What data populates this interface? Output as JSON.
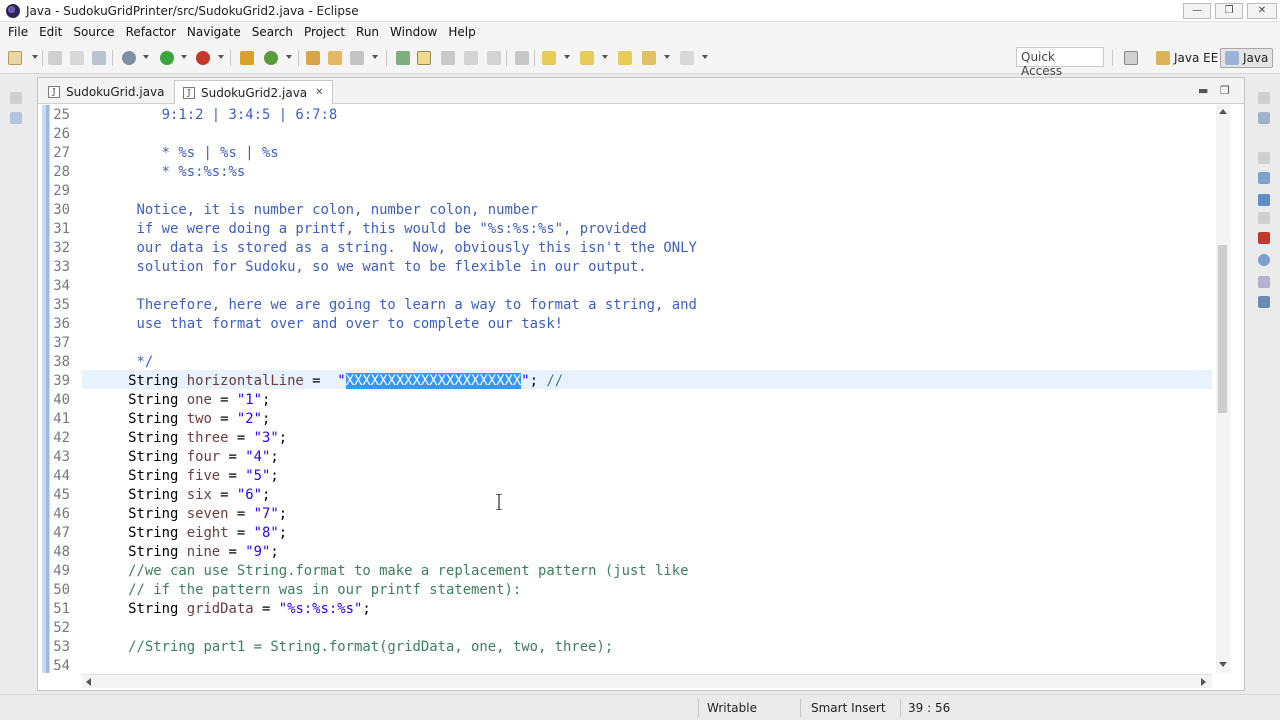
{
  "window": {
    "title": "Java - SudokuGridPrinter/src/SudokuGrid2.java - Eclipse",
    "minimize": "—",
    "maximize": "❐",
    "close": "✕"
  },
  "menu": [
    "File",
    "Edit",
    "Source",
    "Refactor",
    "Navigate",
    "Search",
    "Project",
    "Run",
    "Window",
    "Help"
  ],
  "quick_access": "Quick Access",
  "perspectives": {
    "javaee": "Java EE",
    "java": "Java"
  },
  "tabs": [
    {
      "label": "SudokuGrid.java",
      "active": false
    },
    {
      "label": "SudokuGrid2.java",
      "active": true,
      "close": "✕"
    }
  ],
  "editor": {
    "current_line": 39,
    "lines": [
      {
        "n": "25",
        "segs": [
          {
            "t": "          9:1:2 | 3:4:5 | 6:7:8",
            "c": "txt"
          }
        ]
      },
      {
        "n": "26",
        "segs": []
      },
      {
        "n": "27",
        "segs": [
          {
            "t": "          * %s | %s | %s",
            "c": "txt"
          }
        ]
      },
      {
        "n": "28",
        "segs": [
          {
            "t": "          * %s:%s:%s",
            "c": "txt"
          }
        ]
      },
      {
        "n": "29",
        "segs": []
      },
      {
        "n": "30",
        "segs": [
          {
            "t": "       Notice, it is number colon, number colon, number",
            "c": "txt"
          }
        ]
      },
      {
        "n": "31",
        "segs": [
          {
            "t": "       if we were doing a printf, this would be \"%s:%s:%s\", provided",
            "c": "txt"
          }
        ]
      },
      {
        "n": "32",
        "segs": [
          {
            "t": "       our data is stored as a string.  Now, obviously this isn't the ONLY",
            "c": "txt"
          }
        ]
      },
      {
        "n": "33",
        "segs": [
          {
            "t": "       solution for Sudoku, so we want to be flexible in our output.",
            "c": "txt"
          }
        ]
      },
      {
        "n": "34",
        "segs": []
      },
      {
        "n": "35",
        "segs": [
          {
            "t": "       Therefore, here we are going to learn a way to format a string, and",
            "c": "txt"
          }
        ]
      },
      {
        "n": "36",
        "segs": [
          {
            "t": "       use that format over and over to complete our task!",
            "c": "txt"
          }
        ]
      },
      {
        "n": "37",
        "segs": []
      },
      {
        "n": "38",
        "segs": [
          {
            "t": "       */",
            "c": "txt"
          }
        ]
      },
      {
        "n": "39",
        "segs": [
          {
            "t": "      String ",
            "c": "kw"
          },
          {
            "t": "horizontalLine",
            "c": "id"
          },
          {
            "t": " =  ",
            "c": "kw"
          },
          {
            "t": "\"",
            "c": "str"
          },
          {
            "t": "XXXXXXXXXXXXXXXXXXXXX",
            "c": "sel"
          },
          {
            "t": "\"",
            "c": "str"
          },
          {
            "t": "; ",
            "c": "kw"
          },
          {
            "t": "//",
            "c": "cm"
          }
        ]
      },
      {
        "n": "40",
        "segs": [
          {
            "t": "      String ",
            "c": "kw"
          },
          {
            "t": "one",
            "c": "id"
          },
          {
            "t": " = ",
            "c": "kw"
          },
          {
            "t": "\"1\"",
            "c": "str"
          },
          {
            "t": ";",
            "c": "kw"
          }
        ]
      },
      {
        "n": "41",
        "segs": [
          {
            "t": "      String ",
            "c": "kw"
          },
          {
            "t": "two",
            "c": "id"
          },
          {
            "t": " = ",
            "c": "kw"
          },
          {
            "t": "\"2\"",
            "c": "str"
          },
          {
            "t": ";",
            "c": "kw"
          }
        ]
      },
      {
        "n": "42",
        "segs": [
          {
            "t": "      String ",
            "c": "kw"
          },
          {
            "t": "three",
            "c": "id"
          },
          {
            "t": " = ",
            "c": "kw"
          },
          {
            "t": "\"3\"",
            "c": "str"
          },
          {
            "t": ";",
            "c": "kw"
          }
        ]
      },
      {
        "n": "43",
        "segs": [
          {
            "t": "      String ",
            "c": "kw"
          },
          {
            "t": "four",
            "c": "id"
          },
          {
            "t": " = ",
            "c": "kw"
          },
          {
            "t": "\"4\"",
            "c": "str"
          },
          {
            "t": ";",
            "c": "kw"
          }
        ]
      },
      {
        "n": "44",
        "segs": [
          {
            "t": "      String ",
            "c": "kw"
          },
          {
            "t": "five",
            "c": "id"
          },
          {
            "t": " = ",
            "c": "kw"
          },
          {
            "t": "\"5\"",
            "c": "str"
          },
          {
            "t": ";",
            "c": "kw"
          }
        ]
      },
      {
        "n": "45",
        "segs": [
          {
            "t": "      String ",
            "c": "kw"
          },
          {
            "t": "six",
            "c": "id"
          },
          {
            "t": " = ",
            "c": "kw"
          },
          {
            "t": "\"6\"",
            "c": "str"
          },
          {
            "t": ";",
            "c": "kw"
          }
        ]
      },
      {
        "n": "46",
        "segs": [
          {
            "t": "      String ",
            "c": "kw"
          },
          {
            "t": "seven",
            "c": "id"
          },
          {
            "t": " = ",
            "c": "kw"
          },
          {
            "t": "\"7\"",
            "c": "str"
          },
          {
            "t": ";",
            "c": "kw"
          }
        ]
      },
      {
        "n": "47",
        "segs": [
          {
            "t": "      String ",
            "c": "kw"
          },
          {
            "t": "eight",
            "c": "id"
          },
          {
            "t": " = ",
            "c": "kw"
          },
          {
            "t": "\"8\"",
            "c": "str"
          },
          {
            "t": ";",
            "c": "kw"
          }
        ]
      },
      {
        "n": "48",
        "segs": [
          {
            "t": "      String ",
            "c": "kw"
          },
          {
            "t": "nine",
            "c": "id"
          },
          {
            "t": " = ",
            "c": "kw"
          },
          {
            "t": "\"9\"",
            "c": "str"
          },
          {
            "t": ";",
            "c": "kw"
          }
        ]
      },
      {
        "n": "49",
        "segs": [
          {
            "t": "      //we can use String.format to make a replacement pattern (just like",
            "c": "cm"
          }
        ]
      },
      {
        "n": "50",
        "segs": [
          {
            "t": "      // if the pattern was in our printf statement):",
            "c": "cm"
          }
        ]
      },
      {
        "n": "51",
        "segs": [
          {
            "t": "      String ",
            "c": "kw"
          },
          {
            "t": "gridData",
            "c": "id"
          },
          {
            "t": " = ",
            "c": "kw"
          },
          {
            "t": "\"%s:%s:%s\"",
            "c": "str"
          },
          {
            "t": ";",
            "c": "kw"
          }
        ]
      },
      {
        "n": "52",
        "segs": []
      },
      {
        "n": "53",
        "segs": [
          {
            "t": "      //String part1 = String.format(gridData, one, two, three);",
            "c": "cm"
          }
        ]
      },
      {
        "n": "54",
        "segs": []
      }
    ]
  },
  "status": {
    "mode": "Writable",
    "insert": "Smart Insert",
    "position": "39 : 56"
  },
  "colors": {
    "comment": "#3f5fbf",
    "line_comment": "#3f7f5f",
    "string": "#2a00ff",
    "variable": "#6a3e3e",
    "selection": "#3399ff",
    "current_line": "#e8f2fe"
  }
}
